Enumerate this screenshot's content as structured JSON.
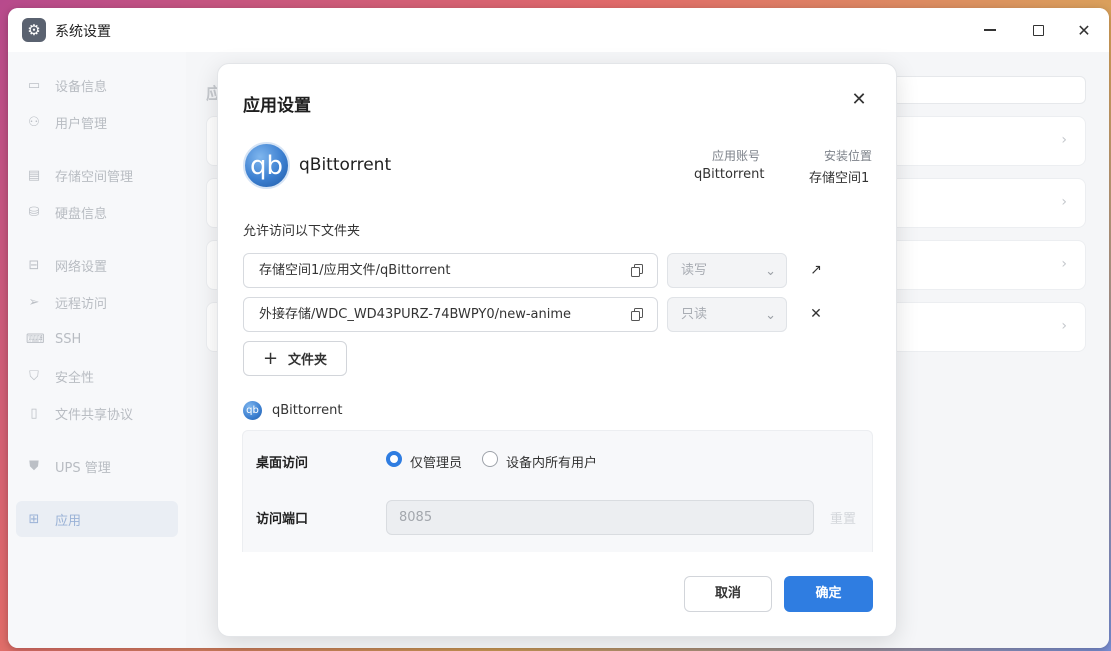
{
  "window": {
    "title": "系统设置",
    "app_icon": "gear-icon",
    "controls": {
      "minimize": "minimize-icon",
      "maximize": "maximize-icon",
      "close": "✕"
    }
  },
  "sidebar": {
    "items": [
      {
        "label": "设备信息",
        "icon": "▭"
      },
      {
        "label": "用户管理",
        "icon": "⚇"
      },
      {
        "label": "存储空间管理",
        "icon": "▤"
      },
      {
        "label": "硬盘信息",
        "icon": "⛁"
      },
      {
        "label": "网络设置",
        "icon": "⊟"
      },
      {
        "label": "远程访问",
        "icon": "➢"
      },
      {
        "label": "SSH",
        "icon": "⌨"
      },
      {
        "label": "安全性",
        "icon": "⛉"
      },
      {
        "label": "文件共享协议",
        "icon": "▯"
      },
      {
        "label": "UPS 管理",
        "icon": "⛊"
      },
      {
        "label": "应用",
        "icon": "⊞",
        "active": true
      }
    ]
  },
  "content": {
    "title_partial": "应"
  },
  "dialog": {
    "title": "应用设置",
    "close_glyph": "✕",
    "app": {
      "logo_text": "qb",
      "name": "qBittorrent",
      "account_label": "应用账号",
      "account_value": "qBittorrent",
      "location_label": "安装位置",
      "location_value": "存储空间1"
    },
    "folders_label": "允许访问以下文件夹",
    "folders": [
      {
        "path": "存储空间1/应用文件/qBittorrent",
        "permission": "读写",
        "action": "↗"
      },
      {
        "path": "外接存储/WDC_WD43PURZ-74BWPY0/new-anime",
        "permission": "只读",
        "action": "✕"
      }
    ],
    "add_folder_label": "文件夹",
    "add_folder_plus": "+",
    "app_section": {
      "logo_text": "qb",
      "name": "qBittorrent",
      "desktop_access_label": "桌面访问",
      "desktop_access_options": [
        "仅管理员",
        "设备内所有用户"
      ],
      "desktop_access_selected": "仅管理员",
      "port_label": "访问端口",
      "port_value": "8085",
      "reset_label": "重置"
    },
    "cancel_label": "取消",
    "confirm_label": "确定"
  },
  "colors": {
    "accent": "#2f7de1",
    "dialog_bg": "#ffffff",
    "sidebar_text": "#b8bcc2"
  }
}
